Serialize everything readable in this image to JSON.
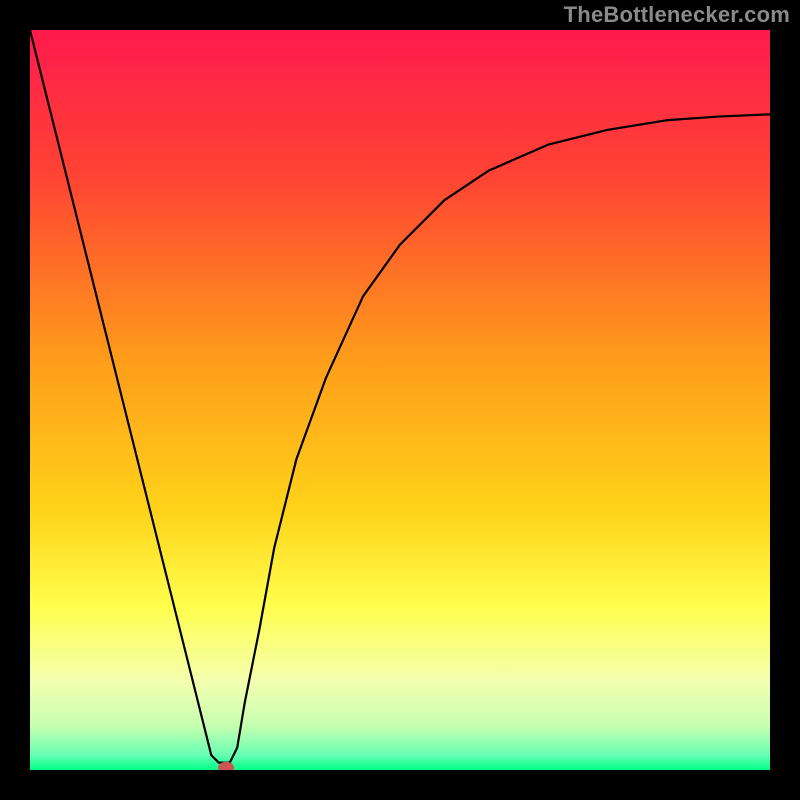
{
  "watermark": "TheBottlenecker.com",
  "chart_data": {
    "type": "line",
    "title": "",
    "xlabel": "",
    "ylabel": "",
    "xlim": [
      0,
      100
    ],
    "ylim": [
      0,
      100
    ],
    "gradient_stops": [
      {
        "offset": 0,
        "color": "#ff1a4d"
      },
      {
        "offset": 20,
        "color": "#ff4433"
      },
      {
        "offset": 45,
        "color": "#ff9e1a"
      },
      {
        "offset": 65,
        "color": "#ffd31a"
      },
      {
        "offset": 78,
        "color": "#ffff4d"
      },
      {
        "offset": 88,
        "color": "#f4ffb0"
      },
      {
        "offset": 94,
        "color": "#c7ffb0"
      },
      {
        "offset": 98,
        "color": "#66ffb3"
      },
      {
        "offset": 100,
        "color": "#00ff88"
      }
    ],
    "series": [
      {
        "name": "bottleneck-curve",
        "color": "#000000",
        "x": [
          0,
          5,
          10,
          15,
          19,
          22,
          24.5,
          25.5,
          27,
          28,
          29,
          31,
          33,
          36,
          40,
          45,
          50,
          56,
          62,
          70,
          78,
          86,
          93,
          100
        ],
        "y": [
          100,
          80,
          60,
          40,
          24,
          12,
          2,
          1,
          1,
          3,
          9,
          19,
          30,
          42,
          53,
          64,
          71,
          77,
          81,
          84.5,
          86.5,
          87.8,
          88.3,
          88.6
        ]
      }
    ],
    "marker": {
      "x": 26.5,
      "y": 0.3,
      "color": "#cc5555"
    }
  }
}
